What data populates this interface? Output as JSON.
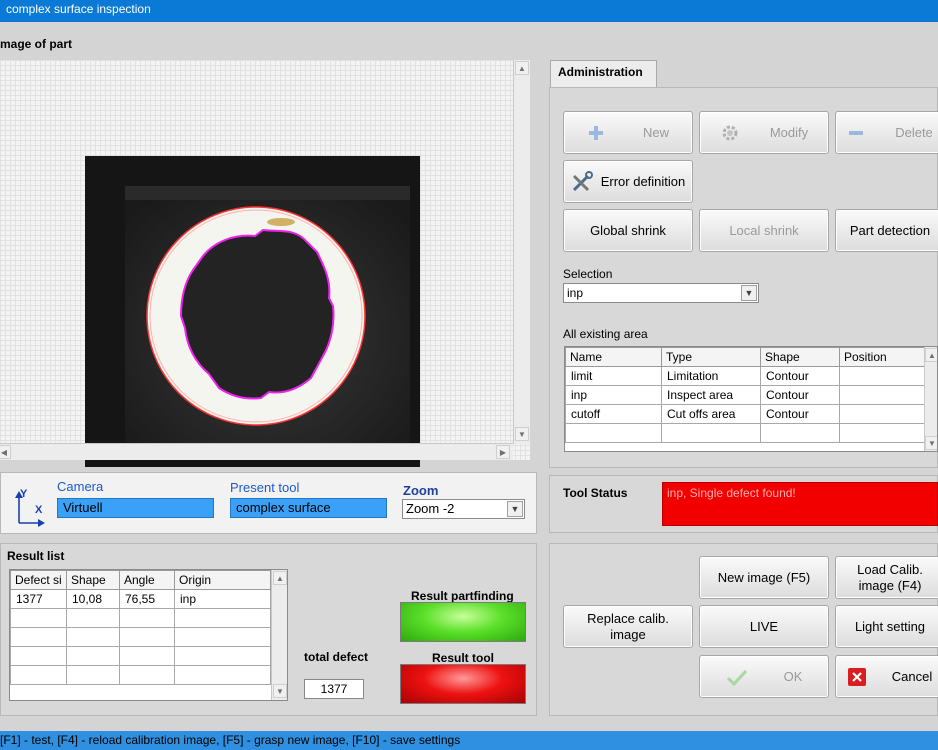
{
  "window": {
    "title": "complex surface inspection"
  },
  "image_panel": {
    "label": "mage of part"
  },
  "camera": {
    "label": "Camera",
    "value": "Virtuell"
  },
  "present_tool": {
    "label": "Present tool",
    "value": "complex surface"
  },
  "zoom": {
    "label": "Zoom",
    "value": "Zoom -2"
  },
  "axes": {
    "y": "Y",
    "x": "X"
  },
  "result_list": {
    "label": "Result list",
    "columns": [
      "Defect si",
      "Shape",
      "Angle",
      "Origin"
    ],
    "rows": [
      [
        "1377",
        "10,08",
        "76,55",
        "inp"
      ]
    ]
  },
  "total_defect": {
    "label": "total defect",
    "value": "1377"
  },
  "result_partfinding": {
    "label": "Result partfinding",
    "color": "#4fd420"
  },
  "result_tool": {
    "label": "Result tool",
    "color": "#e01010"
  },
  "administration": {
    "tab": "Administration",
    "buttons": {
      "new": "New",
      "modify": "Modify",
      "delete": "Delete",
      "error_definition": "Error definition",
      "global_shrink": "Global shrink",
      "local_shrink": "Local shrink",
      "part_detection": "Part detection"
    },
    "selection": {
      "label": "Selection",
      "value": "inp"
    },
    "areas": {
      "label": "All existing area",
      "columns": [
        "Name",
        "Type",
        "Shape",
        "Position"
      ],
      "rows": [
        [
          "limit",
          "Limitation",
          "Contour",
          ""
        ],
        [
          "inp",
          "Inspect area",
          "Contour",
          ""
        ],
        [
          "cutoff",
          "Cut offs area",
          "Contour",
          ""
        ]
      ]
    }
  },
  "tool_status": {
    "label": "Tool Status",
    "message": "inp, Single defect found!"
  },
  "actions": {
    "new_image": "New image (F5)",
    "load_calib_line1": "Load Calib.",
    "load_calib_line2": "image (F4)",
    "replace_calib_line1": "Replace calib.",
    "replace_calib_line2": "image",
    "live": "LIVE",
    "light_setting": "Light setting",
    "ok": "OK",
    "cancel": "Cancel"
  },
  "statusbar": {
    "text": "[F1] - test, [F4] - reload calibration image, [F5] - grasp new image, [F10] - save settings"
  },
  "colors": {
    "titlebar": "#0a7ad6",
    "statusbar": "#2f8fe0",
    "field": "#3aa0f8",
    "tool_status": "#f20000"
  }
}
